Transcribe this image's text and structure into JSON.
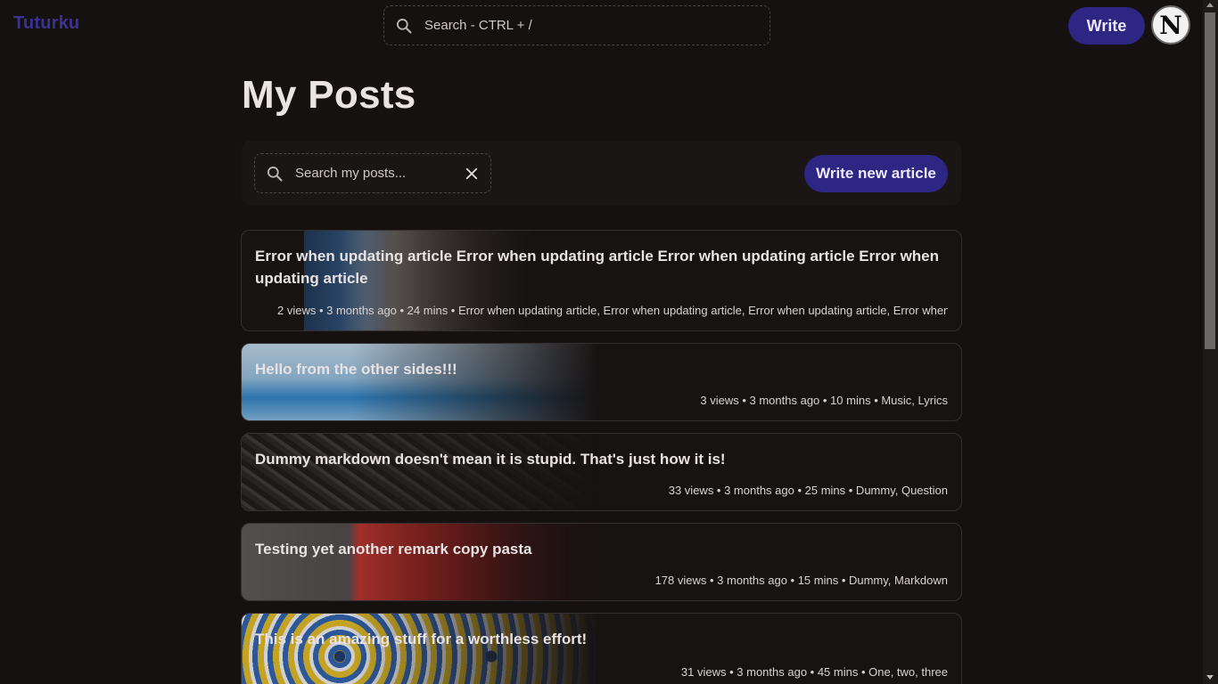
{
  "header": {
    "brand": "Tuturku",
    "search_placeholder": "Search - CTRL + /",
    "write_label": "Write",
    "avatar_letter": "N"
  },
  "main": {
    "title": "My Posts",
    "search_placeholder": "Search my posts...",
    "new_article_label": "Write new article"
  },
  "posts": [
    {
      "title": "Error when updating article Error when updating article Error when updating article Error when updating article",
      "meta": "2 views • 3 months ago • 24 mins • Error when updating article, Error when updating article, Error when updating article, Error when"
    },
    {
      "title": "Hello from the other sides!!!",
      "meta": "3 views • 3 months ago • 10 mins • Music, Lyrics"
    },
    {
      "title": "Dummy markdown doesn't mean it is stupid. That's just how it is!",
      "meta": "33 views • 3 months ago • 25 mins • Dummy, Question"
    },
    {
      "title": "Testing yet another remark copy pasta",
      "meta": "178 views • 3 months ago • 15 mins • Dummy, Markdown"
    },
    {
      "title": "This is an amazing stuff for a worthless effort!",
      "meta": "31 views • 3 months ago • 45 mins • One, two, three"
    }
  ],
  "colors": {
    "background": "#161111",
    "accent": "#2d2683",
    "brand": "#3b3296"
  },
  "icons": {
    "search": "search-icon",
    "clear": "close-icon"
  }
}
